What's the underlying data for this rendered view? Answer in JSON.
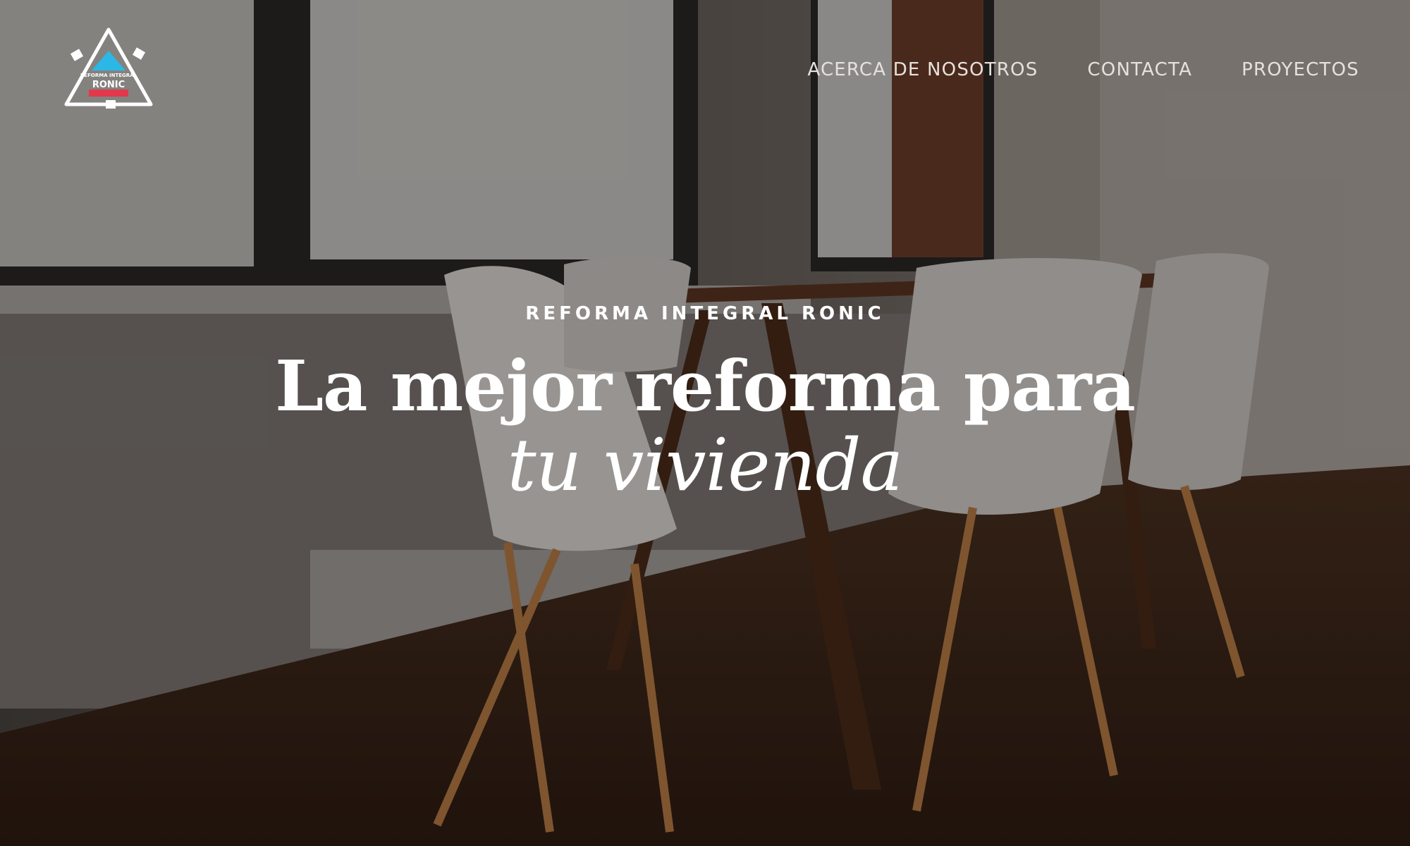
{
  "logo": {
    "line1": "REFORMA INTEGRAL",
    "line2": "RONIC"
  },
  "nav": {
    "items": [
      "ACERCA DE NOSOTROS",
      "CONTACTA",
      "PROYECTOS"
    ]
  },
  "hero": {
    "eyebrow": "REFORMA INTEGRAL RONIC",
    "headline_line1": "La mejor reforma para",
    "headline_line2": "tu vivienda",
    "background_image": "office-room-white-chairs-wooden-table"
  },
  "colors": {
    "logo_triangle": "#2bb8e6",
    "logo_bar": "#e2384c",
    "nav_text": "#e6e1dc",
    "hero_text": "#ffffff"
  }
}
